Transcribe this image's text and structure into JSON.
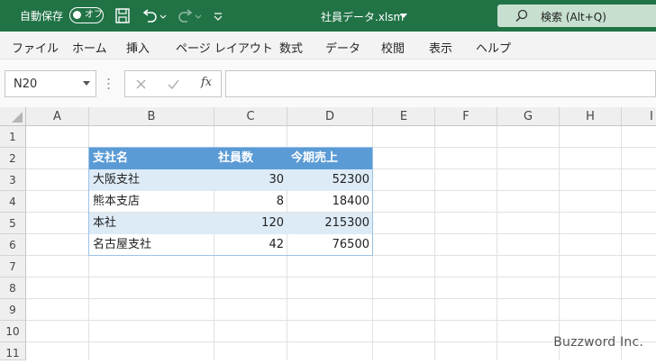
{
  "titlebar": {
    "autosave_label": "自動保存",
    "toggle_label": "オフ",
    "filename": "社員データ.xlsm",
    "search_placeholder": "検索 (Alt+Q)"
  },
  "menu": [
    "ファイル",
    "ホーム",
    "挿入",
    "ページ レイアウト",
    "数式",
    "データ",
    "校閲",
    "表示",
    "ヘルプ"
  ],
  "formula_bar": {
    "name_box": "N20",
    "fx": "fx",
    "formula": ""
  },
  "columns": [
    "A",
    "B",
    "C",
    "D",
    "E",
    "F",
    "G",
    "H",
    "I"
  ],
  "rows": [
    "1",
    "2",
    "3",
    "4",
    "5",
    "6",
    "7",
    "8",
    "9",
    "10",
    "11"
  ],
  "table": {
    "headers": [
      "支社名",
      "社員数",
      "今期売上"
    ],
    "rows": [
      [
        "大阪支社",
        "30",
        "52300"
      ],
      [
        "熊本支店",
        "8",
        "18400"
      ],
      [
        "本社",
        "120",
        "215300"
      ],
      [
        "名古屋支社",
        "42",
        "76500"
      ]
    ]
  },
  "watermark": "Buzzword Inc.",
  "colors": {
    "accent": "#217346",
    "table_header": "#5b9bd5",
    "table_band": "#ddebf7"
  }
}
